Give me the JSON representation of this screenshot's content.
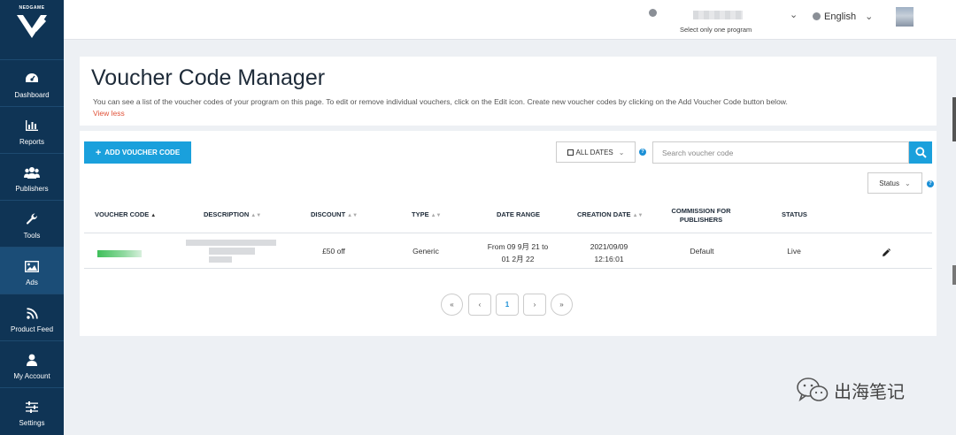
{
  "sidebar": {
    "logo_text": "NEDGAME",
    "items": [
      {
        "label": "Dashboard",
        "icon": "dashboard-icon"
      },
      {
        "label": "Reports",
        "icon": "bar-chart-icon"
      },
      {
        "label": "Publishers",
        "icon": "users-icon"
      },
      {
        "label": "Tools",
        "icon": "wrench-icon"
      },
      {
        "label": "Ads",
        "icon": "image-icon"
      },
      {
        "label": "Product Feed",
        "icon": "rss-icon"
      },
      {
        "label": "My Account",
        "icon": "user-icon"
      },
      {
        "label": "Settings",
        "icon": "sliders-icon"
      }
    ],
    "active": "Ads"
  },
  "topbar": {
    "program_note": "Select only one program",
    "language": "English"
  },
  "header": {
    "title": "Voucher Code Manager",
    "description": "You can see a list of the voucher codes of your program on this page. To edit or remove individual vouchers, click on the Edit icon. Create new voucher codes by clicking on the Add Voucher Code button below.",
    "view_less": "View less"
  },
  "toolbar": {
    "add_label": "ADD VOUCHER CODE",
    "dates_label": "ALL DATES",
    "search_placeholder": "Search voucher code",
    "status_label": "Status"
  },
  "table": {
    "columns": {
      "voucher_code": "VOUCHER CODE",
      "description": "DESCRIPTION",
      "discount": "DISCOUNT",
      "type": "TYPE",
      "date_range": "DATE RANGE",
      "creation_date": "CREATION DATE",
      "commission_line1": "COMMISSION FOR",
      "commission_line2": "PUBLISHERS",
      "status": "STATUS"
    },
    "rows": [
      {
        "discount": "£50 off",
        "type": "Generic",
        "date_range_line1": "From 09 9月 21 to",
        "date_range_line2": "01 2月 22",
        "creation_date_line1": "2021/09/09",
        "creation_date_line2": "12:16:01",
        "commission": "Default",
        "status": "Live"
      }
    ]
  },
  "pagination": {
    "first": "«",
    "prev": "‹",
    "current": "1",
    "next": "›",
    "last": "»"
  },
  "watermark": {
    "text": "出海笔记"
  },
  "colors": {
    "sidebar_bg": "#0f3455",
    "accent": "#1aa0dc",
    "link_red": "#e0533a"
  }
}
